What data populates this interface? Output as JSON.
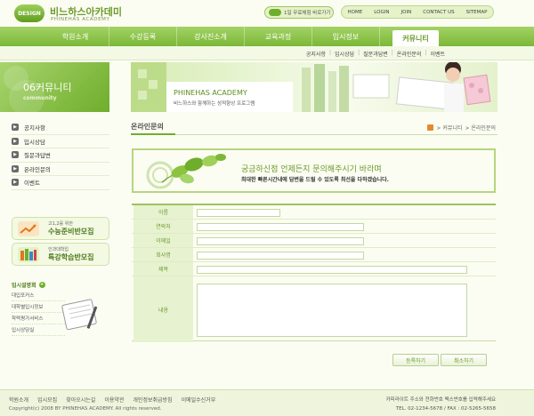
{
  "header": {
    "logo_badge": "DESIGN",
    "logo_title": "비느하스아카데미",
    "logo_subtitle": "PHINEHAS ACADEMY",
    "trial_label": "1일 무료체험 바로가기",
    "links": [
      "HOME",
      "LOGIN",
      "JOIN",
      "CONTACT US",
      "SITEMAP"
    ]
  },
  "nav": {
    "items": [
      "학원소개",
      "수강등록",
      "강사진소개",
      "교육과정",
      "입시정보",
      "커뮤니티"
    ],
    "active_index": 5
  },
  "subnav": {
    "items": [
      "공지사항",
      "입시상담",
      "질문과답변",
      "온라인문의",
      "이벤트"
    ]
  },
  "sidebar": {
    "hero_title": "06커뮤니티",
    "hero_subtitle": "community",
    "menu": [
      "공지사항",
      "입시상담",
      "질문과답변",
      "온라인문의",
      "이벤트"
    ],
    "promos": [
      {
        "small": "고1,2를 위한",
        "big": "수능준비반모집",
        "icon_color": "#e9a23b"
      },
      {
        "small": "인과대학입",
        "big": "특강학습반모집",
        "icon_color": "#6fae2b"
      }
    ],
    "cs_title": "입시설명회",
    "cs_items": [
      "대입포커스",
      "대학별입시정보",
      "학력평가서비스",
      "입시상담실"
    ]
  },
  "hero": {
    "title_en": "PHINEHAS ACADEMY",
    "tagline": "비느하스와 함께하는 성적향상 프로그램"
  },
  "content": {
    "title": "온라인문의",
    "breadcrumb": [
      "커뮤니티",
      "온라인문의"
    ],
    "intro_headline": "궁금하신점 언제든지 문의해주시기 바라며",
    "intro_sub": "최대한 빠른시간내에 답변을 드릴 수 있도록 최선을 다하겠습니다."
  },
  "form": {
    "fields": [
      {
        "label": "이름",
        "value": ""
      },
      {
        "label": "연락처",
        "value": ""
      },
      {
        "label": "이메일",
        "value": ""
      },
      {
        "label": "회사명",
        "value": ""
      },
      {
        "label": "제목",
        "value": ""
      }
    ],
    "message_label": "내용",
    "message_value": "",
    "submit_label": "등록하기",
    "cancel_label": "취소하기"
  },
  "footer": {
    "links": [
      "학원소개",
      "입시모집",
      "찾아오시는길",
      "이용약관",
      "개인정보취급방침",
      "이메일수신거부"
    ],
    "copyright": "Copyright(c) 2008 BY PHINEHAS ACADEMY. All rights reserved.",
    "contact": "카피라이트 주소와 전화번호 팩스번호를 입력해주세요",
    "tel": "TEL. 02-1234-5678 / FAX : 02-5265-5658"
  }
}
